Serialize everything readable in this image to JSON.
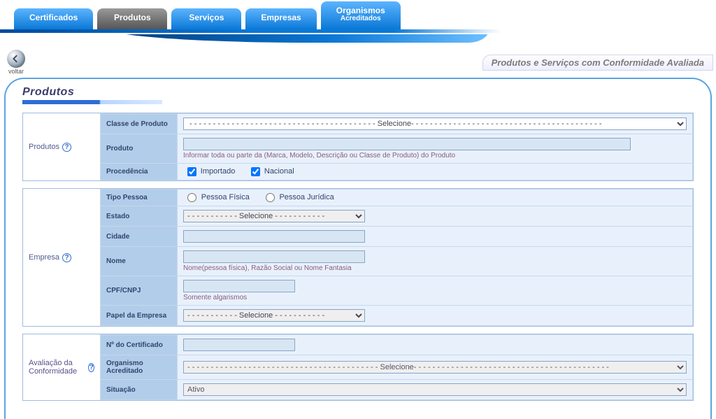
{
  "nav": {
    "tabs": [
      {
        "label": "Certificados"
      },
      {
        "label": "Produtos",
        "active": true
      },
      {
        "label": "Serviços"
      },
      {
        "label": "Empresas"
      },
      {
        "label": "Organismos",
        "sub": "Acreditados"
      }
    ]
  },
  "back_label": "voltar",
  "banner": "Produtos e Serviços com Conformidade Avaliada",
  "page_title": "Produtos",
  "produtos": {
    "legend": "Produtos",
    "classe_label": "Classe de Produto",
    "classe_placeholder": "- - - - - - - - - - - - - - - - - - - - - - - - - - - - - - - - - - - - - - - - Selecione- - - - - - - - - - - - - - - - - - - - - - - - - - - - - - - - - - - - - - - - -",
    "produto_label": "Produto",
    "produto_hint": "Informar toda ou parte da (Marca, Modelo, Descrição ou Classe de Produto) do Produto",
    "procedencia_label": "Procedência",
    "check_importado": "Importado",
    "check_nacional": "Nacional"
  },
  "empresa": {
    "legend": "Empresa",
    "tipo_label": "Tipo Pessoa",
    "tipo_fisica": "Pessoa Física",
    "tipo_juridica": "Pessoa Jurídica",
    "estado_label": "Estado",
    "estado_placeholder": "- - - - - - - - - - - Selecione - - - - - - - - - - -",
    "cidade_label": "Cidade",
    "nome_label": "Nome",
    "nome_hint": "Nome(pessoa física), Razão Social ou Nome Fantasia",
    "cpf_label": "CPF/CNPJ",
    "cpf_hint": "Somente algarismos",
    "papel_label": "Papel da Empresa",
    "papel_placeholder": "- - - - - - - - - - - Selecione - - - - - - - - - - -"
  },
  "avaliacao": {
    "legend": "Avaliação da Conformidade",
    "ncert_label": "Nº do Certificado",
    "org_label": "Organismo Acreditado",
    "org_placeholder": "- - - - - - - - - - - - - - - - - - - - - - - - - - - - - - - - - - - - - - - - - Selecione- - - - - - - - - - - - - - - - - - - - - - - - - - - - - - - - - - - - - - - - - -",
    "situacao_label": "Situação",
    "situacao_value": "Ativo"
  }
}
